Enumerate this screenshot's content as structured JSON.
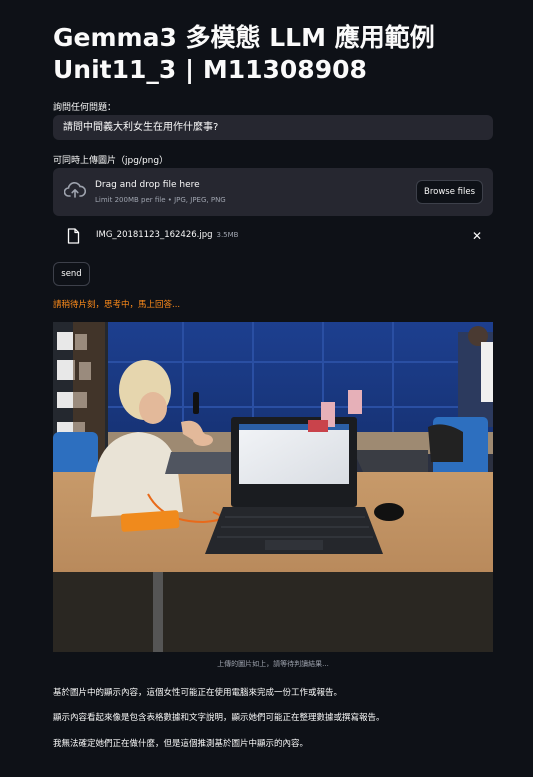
{
  "header": {
    "title_line1": "Gemma3 多模態 LLM 應用範例",
    "title_line2": "Unit11_3 | M11308908"
  },
  "question": {
    "label": "詢問任何問題：",
    "value": "請問中間義大利女生在用作什麼事?"
  },
  "uploader": {
    "label": "可同時上傳圖片（jpg/png）",
    "drop_title": "Drag and drop file here",
    "drop_subtitle": "Limit 200MB per file • JPG, JPEG, PNG",
    "browse_label": "Browse files",
    "icon": "cloud-upload-icon"
  },
  "uploaded_file": {
    "name": "IMG_20181123_162426.jpg",
    "size": "3.5MB",
    "icon": "file-icon",
    "close_glyph": "✕"
  },
  "send_label": "send",
  "status_text": "請稍待片刻，思考中，馬上回答...",
  "image_caption": "上傳的圖片如上，請等待判讀結果...",
  "answer": {
    "line1": "基於圖片中的顯示內容，這個女性可能正在使用電腦來完成一份工作或報告。",
    "line2": "顯示內容看起來像是包含表格數據和文字說明，顯示她們可能正在整理數據或撰寫報告。",
    "line3": "我無法確定她們正在做什麼，但是這個推測基於圖片中顯示的內容。"
  },
  "colors": {
    "background": "#0e1117",
    "input_bg": "#262730",
    "status_orange": "#ff8c1a",
    "muted_text": "#9ea3ae"
  }
}
